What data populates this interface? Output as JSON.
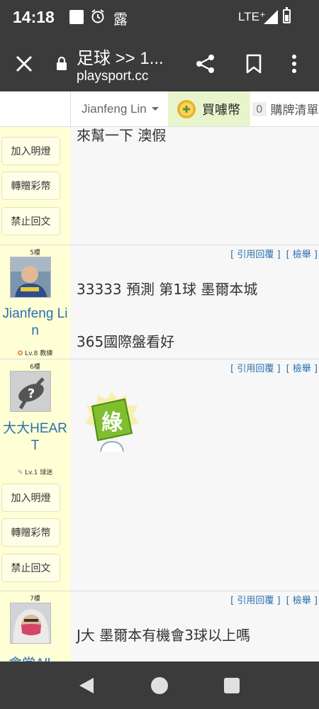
{
  "status_bar": {
    "time": "14:18",
    "weather_char": "露",
    "network": "LTE⁺"
  },
  "toolbar": {
    "title": "足球 >> 1...",
    "url": "playsport.cc"
  },
  "site_header": {
    "username": "Jianfeng Lin",
    "buy_label": "買噱幣",
    "cart_count": "0",
    "cart_label": "購牌清單"
  },
  "posts": {
    "top_partial": {
      "text": "來幫一下 澳假",
      "buttons": [
        "加入明燈",
        "轉贈彩幣",
        "禁止回文"
      ]
    },
    "floor5": {
      "floor": "5樓",
      "username": "Jianfeng Lin",
      "rank": "Lv.8 教練",
      "actions": [
        "[ 引用回覆 ]",
        "[ 檢舉 ]"
      ],
      "lines": [
        "33333 預測 第1球 墨爾本城",
        "365國際盤看好"
      ]
    },
    "floor6": {
      "floor": "6樓",
      "username": "大大HEART",
      "rank": "Lv.1 球迷",
      "actions": [
        "[ 引用回覆 ]",
        "[ 檢舉 ]"
      ],
      "sticker_char": "綠",
      "buttons": [
        "加入明燈",
        "轉贈彩幣",
        "禁止回文"
      ]
    },
    "floor7": {
      "floor": "7樓",
      "username": "會當All...",
      "actions": [
        "[ 引用回覆 ]",
        "[ 檢舉 ]"
      ],
      "text": "J大 墨爾本有機會3球以上嗎"
    }
  },
  "colors": {
    "bar": "#3b3b3b",
    "sidebar": "#ffffd6",
    "link": "#2a6fb0",
    "buy_bg": "#e8f5cc"
  }
}
